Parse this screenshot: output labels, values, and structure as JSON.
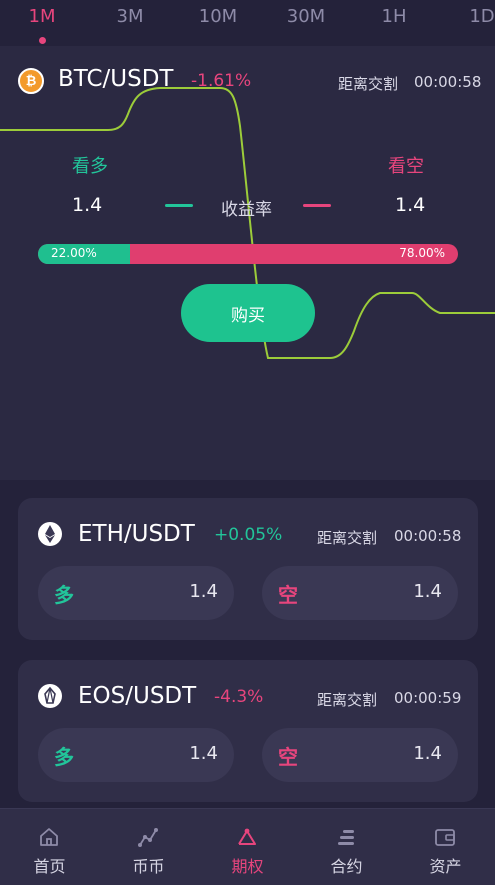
{
  "tabs": [
    {
      "label": "1M",
      "active": true
    },
    {
      "label": "3M",
      "active": false
    },
    {
      "label": "10M",
      "active": false
    },
    {
      "label": "30M",
      "active": false
    },
    {
      "label": "1H",
      "active": false
    },
    {
      "label": "1D",
      "active": false
    }
  ],
  "main": {
    "pair": "BTC/USDT",
    "change": "-1.61%",
    "countdown_label": "距离交割",
    "countdown": "00:00:58",
    "long_label": "看多",
    "short_label": "看空",
    "long_rate": "1.4",
    "short_rate": "1.4",
    "rate_label": "收益率",
    "long_pct_text": "22.00%",
    "short_pct_text": "78.00%",
    "long_pct": 22,
    "buy_label": "购买",
    "icon": "bitcoin-icon"
  },
  "cards": [
    {
      "pair": "ETH/USDT",
      "change": "+0.05%",
      "trend": "up",
      "countdown_label": "距离交割",
      "countdown": "00:00:58",
      "long_label": "多",
      "long_val": "1.4",
      "short_label": "空",
      "short_val": "1.4",
      "icon": "ethereum-icon"
    },
    {
      "pair": "EOS/USDT",
      "change": "-4.3%",
      "trend": "down",
      "countdown_label": "距离交割",
      "countdown": "00:00:59",
      "long_label": "多",
      "long_val": "1.4",
      "short_label": "空",
      "short_val": "1.4",
      "icon": "eos-icon"
    }
  ],
  "nav": [
    {
      "label": "首页",
      "icon": "home-icon",
      "active": false
    },
    {
      "label": "币币",
      "icon": "trend-icon",
      "active": false
    },
    {
      "label": "期权",
      "icon": "options-icon",
      "active": true
    },
    {
      "label": "合约",
      "icon": "contract-icon",
      "active": false
    },
    {
      "label": "资产",
      "icon": "wallet-icon",
      "active": false
    }
  ],
  "colors": {
    "accent_pink": "#e7457d",
    "accent_green": "#22c59a",
    "line_green": "#9ccc3a",
    "background": "#24223a"
  }
}
